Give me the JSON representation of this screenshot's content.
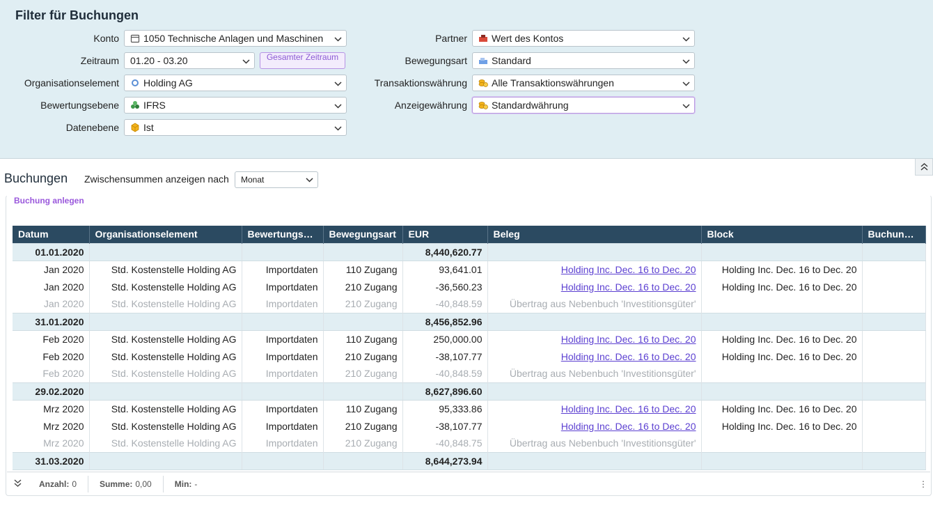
{
  "filter": {
    "title": "Filter für Buchungen",
    "fields": {
      "konto": {
        "label": "Konto",
        "value": "1050 Technische Anlagen und Maschinen",
        "icon": "calendar-icon"
      },
      "zeitraum": {
        "label": "Zeitraum",
        "value": "01.20 - 03.20",
        "button": "Gesamter Zeitraum"
      },
      "organisationselement": {
        "label": "Organisationselement",
        "value": "Holding AG",
        "icon": "circle-icon"
      },
      "bewertungsebene": {
        "label": "Bewertungsebene",
        "value": "IFRS",
        "icon": "recycle-icon"
      },
      "datenebene": {
        "label": "Datenebene",
        "value": "Ist",
        "icon": "cube-icon"
      },
      "partner": {
        "label": "Partner",
        "value": "Wert des Kontos",
        "icon": "partner-icon"
      },
      "bewegungsart": {
        "label": "Bewegungsart",
        "value": "Standard",
        "icon": "movement-icon"
      },
      "transaktionswaehrung": {
        "label": "Transaktionswährung",
        "value": "Alle Transaktionswährungen",
        "icon": "coins-icon"
      },
      "anzeigewaehrung": {
        "label": "Anzeigewährung",
        "value": "Standardwährung",
        "icon": "coins-icon"
      }
    }
  },
  "bookings": {
    "title": "Buchungen",
    "subtotal_label": "Zwischensummen anzeigen nach",
    "subtotal_value": "Monat",
    "create_label": "Buchung anlegen",
    "columns": [
      "Datum",
      "Organisationselement",
      "Bewertungseb…",
      "Bewegungsart",
      "EUR",
      "Beleg",
      "Block",
      "Buchungs…"
    ],
    "rows": [
      {
        "type": "sum",
        "datum": "01.01.2020",
        "eur": "8,440,620.77"
      },
      {
        "type": "row",
        "datum": "Jan 2020",
        "org": "Std. Kostenstelle Holding AG",
        "bew": "Importdaten",
        "art": "110 Zugang",
        "eur": "93,641.01",
        "beleg": "Holding Inc. Dec. 16 to Dec. 20",
        "block": "Holding Inc. Dec. 16 to Dec. 20"
      },
      {
        "type": "row",
        "datum": "Jan 2020",
        "org": "Std. Kostenstelle Holding AG",
        "bew": "Importdaten",
        "art": "210 Zugang",
        "eur": "-36,560.23",
        "beleg": "Holding Inc. Dec. 16 to Dec. 20",
        "block": "Holding Inc. Dec. 16 to Dec. 20"
      },
      {
        "type": "dim",
        "datum": "Jan 2020",
        "org": "Std. Kostenstelle Holding AG",
        "bew": "Importdaten",
        "art": "210 Zugang",
        "eur": "-40,848.59",
        "beleg": "Übertrag aus Nebenbuch 'Investitionsgüter'",
        "block": ""
      },
      {
        "type": "sum",
        "datum": "31.01.2020",
        "eur": "8,456,852.96"
      },
      {
        "type": "row",
        "datum": "Feb 2020",
        "org": "Std. Kostenstelle Holding AG",
        "bew": "Importdaten",
        "art": "110 Zugang",
        "eur": "250,000.00",
        "beleg": "Holding Inc. Dec. 16 to Dec. 20",
        "block": "Holding Inc. Dec. 16 to Dec. 20"
      },
      {
        "type": "row",
        "datum": "Feb 2020",
        "org": "Std. Kostenstelle Holding AG",
        "bew": "Importdaten",
        "art": "210 Zugang",
        "eur": "-38,107.77",
        "beleg": "Holding Inc. Dec. 16 to Dec. 20",
        "block": "Holding Inc. Dec. 16 to Dec. 20"
      },
      {
        "type": "dim",
        "datum": "Feb 2020",
        "org": "Std. Kostenstelle Holding AG",
        "bew": "Importdaten",
        "art": "210 Zugang",
        "eur": "-40,848.59",
        "beleg": "Übertrag aus Nebenbuch 'Investitionsgüter'",
        "block": ""
      },
      {
        "type": "sum",
        "datum": "29.02.2020",
        "eur": "8,627,896.60"
      },
      {
        "type": "row",
        "datum": "Mrz 2020",
        "org": "Std. Kostenstelle Holding AG",
        "bew": "Importdaten",
        "art": "110 Zugang",
        "eur": "95,333.86",
        "beleg": "Holding Inc. Dec. 16 to Dec. 20",
        "block": "Holding Inc. Dec. 16 to Dec. 20"
      },
      {
        "type": "row",
        "datum": "Mrz 2020",
        "org": "Std. Kostenstelle Holding AG",
        "bew": "Importdaten",
        "art": "210 Zugang",
        "eur": "-38,107.77",
        "beleg": "Holding Inc. Dec. 16 to Dec. 20",
        "block": "Holding Inc. Dec. 16 to Dec. 20"
      },
      {
        "type": "dim",
        "datum": "Mrz 2020",
        "org": "Std. Kostenstelle Holding AG",
        "bew": "Importdaten",
        "art": "210 Zugang",
        "eur": "-40,848.75",
        "beleg": "Übertrag aus Nebenbuch 'Investitionsgüter'",
        "block": ""
      },
      {
        "type": "sum",
        "datum": "31.03.2020",
        "eur": "8,644,273.94"
      }
    ]
  },
  "footer": {
    "anzahl_label": "Anzahl:",
    "anzahl": "0",
    "summe_label": "Summe:",
    "summe": "0,00",
    "min_label": "Min:",
    "min": "-"
  }
}
